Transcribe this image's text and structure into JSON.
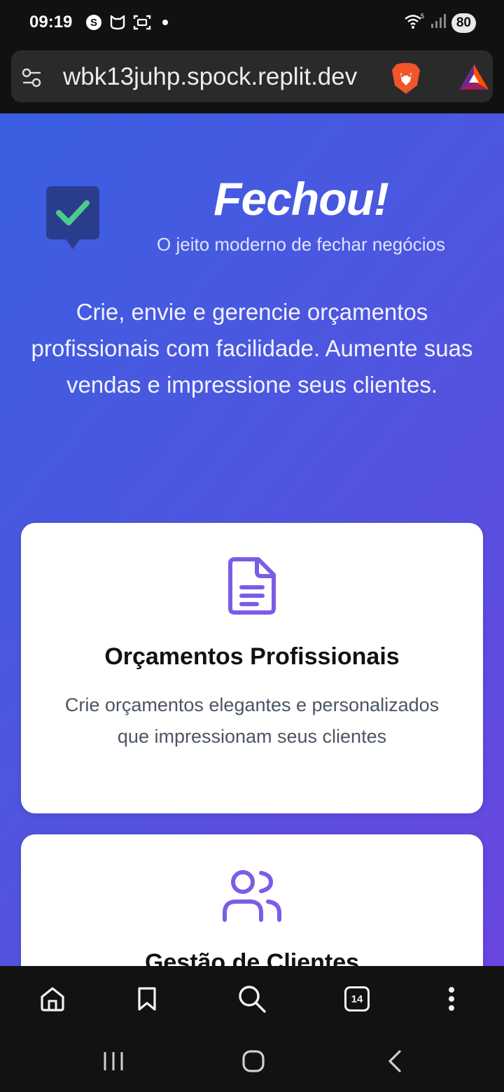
{
  "status_bar": {
    "time": "09:19",
    "battery": "80",
    "icons": [
      "s-circle-icon",
      "cat-icon",
      "scan-icon",
      "dot-icon",
      "wifi-icon",
      "signal-icon"
    ]
  },
  "browser": {
    "url": "wbk13juhp.spock.replit.dev",
    "bottom_nav": [
      "home-icon",
      "bookmark-icon",
      "search-icon",
      "tabs-icon",
      "more-icon"
    ],
    "tab_count": "14"
  },
  "hero": {
    "title": "Fechou!",
    "tagline": "O jeito moderno de fechar negócios",
    "description": "Crie, envie e gerencie orçamentos profissionais com facilidade. Aumente suas vendas e impressione seus clientes."
  },
  "features": [
    {
      "icon": "document-icon",
      "title": "Orçamentos Profissionais",
      "description": "Crie orçamentos elegantes e personalizados que impressionam seus clientes"
    },
    {
      "icon": "users-icon",
      "title": "Gestão de Clientes"
    }
  ],
  "colors": {
    "gradient_start": "#3a5fe0",
    "gradient_end": "#6a46e0",
    "accent_purple": "#7c5ce6",
    "check_green": "#4ccb8a",
    "badge_navy": "#2a3d8c"
  }
}
